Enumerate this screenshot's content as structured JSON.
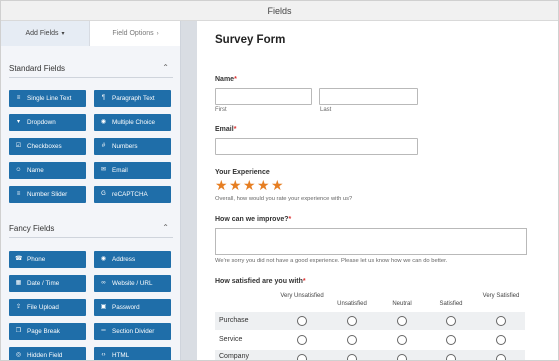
{
  "window": {
    "title": "Fields"
  },
  "tabs": {
    "add_fields": "Add Fields",
    "field_options": "Field Options"
  },
  "standard_fields": {
    "title": "Standard Fields",
    "items": [
      {
        "label": "Single Line Text",
        "icon": "text-lines-icon"
      },
      {
        "label": "Paragraph Text",
        "icon": "paragraph-icon"
      },
      {
        "label": "Dropdown",
        "icon": "dropdown-icon"
      },
      {
        "label": "Multiple Choice",
        "icon": "radio-dot-icon"
      },
      {
        "label": "Checkboxes",
        "icon": "checkbox-icon"
      },
      {
        "label": "Numbers",
        "icon": "hash-icon"
      },
      {
        "label": "Name",
        "icon": "user-icon"
      },
      {
        "label": "Email",
        "icon": "envelope-icon"
      },
      {
        "label": "Number Slider",
        "icon": "slider-icon"
      },
      {
        "label": "reCAPTCHA",
        "icon": "google-icon"
      }
    ]
  },
  "fancy_fields": {
    "title": "Fancy Fields",
    "items": [
      {
        "label": "Phone",
        "icon": "phone-icon"
      },
      {
        "label": "Address",
        "icon": "map-pin-icon"
      },
      {
        "label": "Date / Time",
        "icon": "calendar-icon"
      },
      {
        "label": "Website / URL",
        "icon": "link-icon"
      },
      {
        "label": "File Upload",
        "icon": "upload-icon"
      },
      {
        "label": "Password",
        "icon": "lock-icon"
      },
      {
        "label": "Page Break",
        "icon": "page-break-icon"
      },
      {
        "label": "Section Divider",
        "icon": "divider-icon"
      },
      {
        "label": "Hidden Field",
        "icon": "eye-slash-icon"
      },
      {
        "label": "HTML",
        "icon": "code-icon"
      }
    ]
  },
  "form": {
    "title": "Survey Form",
    "name_label": "Name",
    "first_label": "First",
    "last_label": "Last",
    "email_label": "Email",
    "experience_label": "Your Experience",
    "experience_desc": "Overall, how would you rate your experience with us?",
    "rating": 5,
    "improve_label": "How can we improve?",
    "improve_desc": "We're sorry you did not have a good experience. Please let us know how we can do better.",
    "satisfied_label": "How satisfied are you with",
    "required_mark": "*",
    "likert_columns": [
      "Very Unsatisfied",
      "Unsatisfied",
      "Neutral",
      "Satisfied",
      "Very Satisfied"
    ],
    "likert_rows": [
      "Purchase",
      "Service",
      "Company"
    ]
  },
  "colors": {
    "button_blue": "#1f6ea9",
    "star_orange": "#e67e22",
    "required_red": "#d33333"
  }
}
